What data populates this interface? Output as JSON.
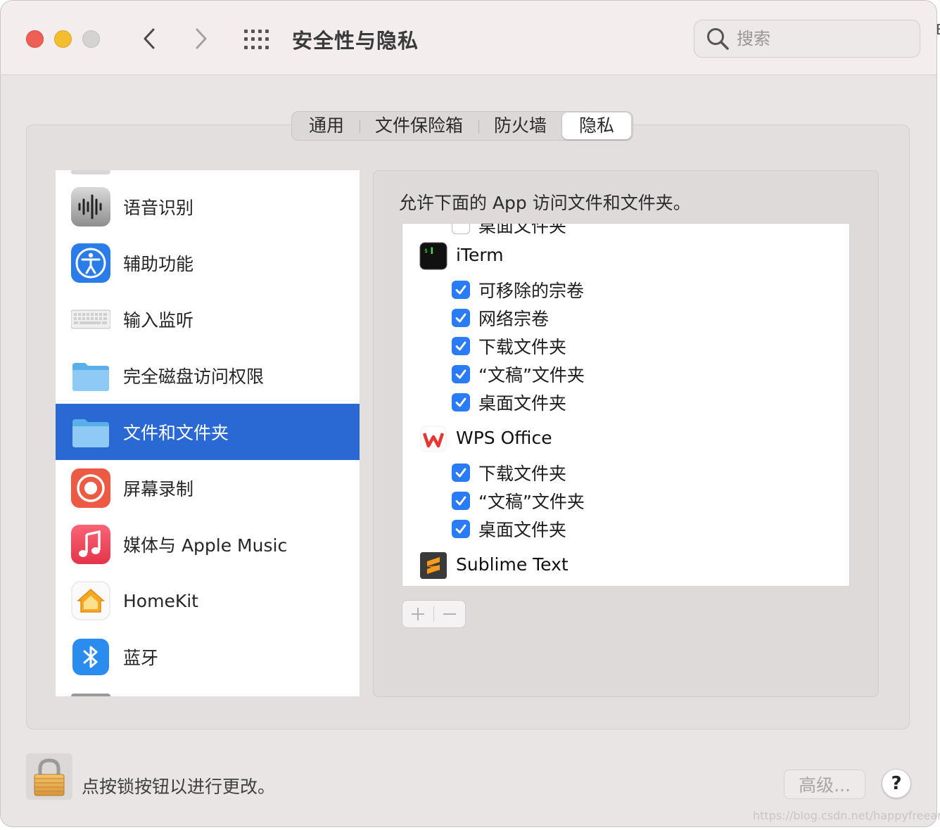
{
  "window": {
    "title": "安全性与隐私"
  },
  "search": {
    "placeholder": "搜索"
  },
  "tabs": [
    {
      "label": "通用"
    },
    {
      "label": "文件保险箱"
    },
    {
      "label": "防火墙"
    },
    {
      "label": "隐私",
      "active": true
    }
  ],
  "sidebar": {
    "items": [
      {
        "label": "语音识别",
        "icon": "waveform-icon"
      },
      {
        "label": "辅助功能",
        "icon": "accessibility-icon"
      },
      {
        "label": "输入监听",
        "icon": "keyboard-icon"
      },
      {
        "label": "完全磁盘访问权限",
        "icon": "folder-icon"
      },
      {
        "label": "文件和文件夹",
        "icon": "folder-icon",
        "selected": true
      },
      {
        "label": "屏幕录制",
        "icon": "screen-record-icon"
      },
      {
        "label": "媒体与 Apple Music",
        "icon": "music-icon"
      },
      {
        "label": "HomeKit",
        "icon": "home-icon"
      },
      {
        "label": "蓝牙",
        "icon": "bluetooth-icon"
      }
    ]
  },
  "main": {
    "heading": "允许下面的 App 访问文件和文件夹。",
    "partial_item": "桌面文件夹",
    "apps": [
      {
        "name": "iTerm",
        "icon": "terminal-icon",
        "permissions": [
          {
            "label": "可移除的宗卷",
            "checked": true
          },
          {
            "label": "网络宗卷",
            "checked": true
          },
          {
            "label": "下载文件夹",
            "checked": true
          },
          {
            "label": "“文稿”文件夹",
            "checked": true
          },
          {
            "label": "桌面文件夹",
            "checked": true
          }
        ]
      },
      {
        "name": "WPS Office",
        "icon": "wps-icon",
        "permissions": [
          {
            "label": "下载文件夹",
            "checked": true
          },
          {
            "label": "“文稿”文件夹",
            "checked": true
          },
          {
            "label": "桌面文件夹",
            "checked": true
          }
        ]
      },
      {
        "name": "Sublime Text",
        "icon": "sublime-icon",
        "permissions": []
      }
    ],
    "add_label": "+",
    "remove_label": "−"
  },
  "footer": {
    "lock_text": "点按锁按钮以进行更改。",
    "advanced_label": "高级...",
    "help_label": "?"
  },
  "watermark": "https://blog.csdn.net/happyfreeangel",
  "edge_char": "E",
  "colors": {
    "selection": "#2a68d4",
    "checkbox": "#2a7cf6",
    "close": "#ee5f55",
    "minimize": "#f4bd2f"
  }
}
